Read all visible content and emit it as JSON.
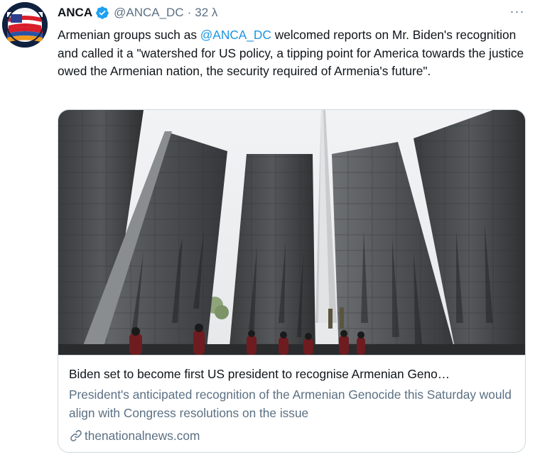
{
  "author": {
    "display_name": "ANCA",
    "handle": "@ANCA_DC",
    "separator": "·",
    "time": "32 λ",
    "avatar_icon": "anca-logo-flag-icon",
    "verified_icon": "verified-badge-icon"
  },
  "more_button": {
    "icon": "more-dots-icon",
    "label": "···"
  },
  "tweet": {
    "text_before": "Armenian groups such as ",
    "mention": "@ANCA_DC",
    "text_after": " welcomed reports on Mr. Biden's recognition and called it a \"watershed for US policy, a tipping point for America towards the justice owed the Armenian nation, the security required of Armenia's future\"."
  },
  "link_card": {
    "image_alt": "Armenian Genocide memorial slabs with people at the eternal flame",
    "title": "Biden set to become first US president to recognise Armenian Geno…",
    "description": "President's anticipated recognition of the Armenian Genocide this Saturday would align with Congress resolutions on the issue",
    "domain": "thenationalnews.com",
    "domain_icon": "link-icon"
  },
  "colors": {
    "text": "#0f1419",
    "secondary": "#5b7083",
    "link": "#1b95e0",
    "verified": "#1da1f2",
    "border": "#cfd9de"
  }
}
